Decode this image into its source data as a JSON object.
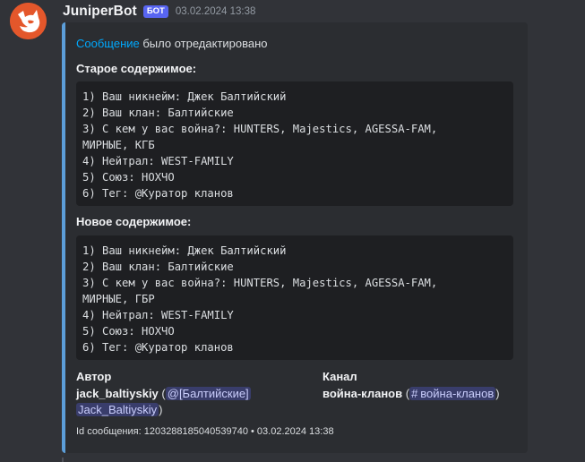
{
  "message": {
    "username": "JuniperBot",
    "bot_tag": "БОТ",
    "timestamp": "03.02.2024 13:38",
    "accent_color": "#5c9ed9"
  },
  "embed": {
    "description_link": "Сообщение",
    "description_rest": " было отредактировано",
    "old_title": "Старое содержимое:",
    "old_lines": [
      "1) Ваш никнейм: Джек Балтийский",
      "2) Ваш клан: Балтийские",
      "3) С кем у вас война?: HUNTERS, Majestics, AGESSA-FAM,",
      "МИРНЫЕ, КГБ",
      "4) Нейтрал: WEST-FAMILY",
      "5) Союз: НОХЧО",
      "6) Тег: @Куратор кланов"
    ],
    "new_title": "Новое содержимое:",
    "new_lines": [
      "1) Ваш никнейм: Джек Балтийский",
      "2) Ваш клан: Балтийские",
      "3) С кем у вас война?: HUNTERS, Majestics, AGESSA-FAM,",
      "МИРНЫЕ, ГБР",
      "4) Нейтрал: WEST-FAMILY",
      "5) Союз: НОХЧО",
      "6) Тег: @Куратор кланов"
    ],
    "author": {
      "label": "Автор",
      "name": "jack_baltiyskiy",
      "mention_line1": "@[Балтийские]",
      "mention_line2": "Jack_Baltiyskiy"
    },
    "channel": {
      "label": "Канал",
      "name": "война-кланов",
      "mention": "война-кланов"
    },
    "footer": "Id сообщения: 1203288185040539740 • 03.02.2024 13:38"
  }
}
